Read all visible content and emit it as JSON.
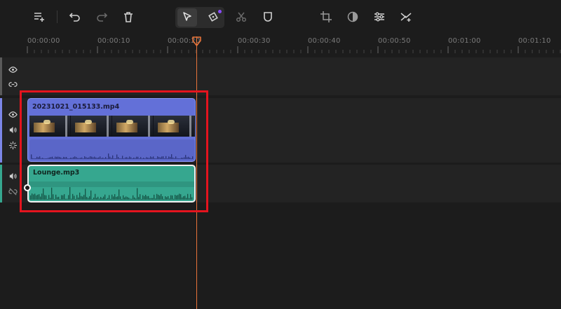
{
  "toolbar": {
    "buttons": [
      {
        "name": "add-track-icon"
      },
      {
        "name": "undo-icon"
      },
      {
        "name": "redo-icon"
      },
      {
        "name": "delete-icon"
      },
      {
        "name": "select-tool-icon"
      },
      {
        "name": "marker-tool-icon"
      },
      {
        "name": "split-icon"
      },
      {
        "name": "mask-icon"
      },
      {
        "name": "crop-icon"
      },
      {
        "name": "color-icon"
      },
      {
        "name": "adjust-icon"
      },
      {
        "name": "transition-icon"
      }
    ]
  },
  "ruler": {
    "ticks": [
      "00:00:00",
      "00:00:10",
      "00:00:20",
      "00:00:30",
      "00:00:40",
      "00:00:50",
      "00:01:00",
      "00:01:10"
    ]
  },
  "tracks": {
    "video_clip": {
      "name": "20231021_015133.mp4"
    },
    "audio_clip": {
      "name": "Lounge.mp3"
    }
  },
  "colors": {
    "accent": "#e8743a",
    "video_clip": "#6370d8",
    "audio_clip": "#36a78f",
    "highlight": "#e4141e"
  }
}
